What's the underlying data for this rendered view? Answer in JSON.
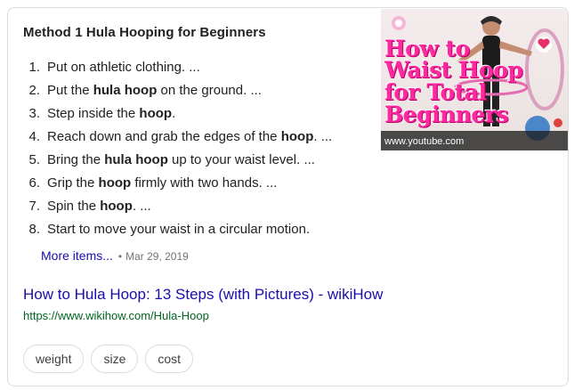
{
  "featured_snippet": {
    "title": "Method 1 Hula Hooping for Beginners",
    "steps": [
      {
        "num": "1.",
        "parts": [
          {
            "text": "Put on athletic clothing. ...",
            "bold": false
          }
        ]
      },
      {
        "num": "2.",
        "parts": [
          {
            "text": "Put the ",
            "bold": false
          },
          {
            "text": "hula hoop",
            "bold": true
          },
          {
            "text": " on the ground. ...",
            "bold": false
          }
        ]
      },
      {
        "num": "3.",
        "parts": [
          {
            "text": "Step inside the ",
            "bold": false
          },
          {
            "text": "hoop",
            "bold": true
          },
          {
            "text": ".",
            "bold": false
          }
        ]
      },
      {
        "num": "4.",
        "parts": [
          {
            "text": "Reach down and grab the edges of the ",
            "bold": false
          },
          {
            "text": "hoop",
            "bold": true
          },
          {
            "text": ". ...",
            "bold": false
          }
        ]
      },
      {
        "num": "5.",
        "parts": [
          {
            "text": "Bring the ",
            "bold": false
          },
          {
            "text": "hula hoop",
            "bold": true
          },
          {
            "text": " up to your waist level. ...",
            "bold": false
          }
        ]
      },
      {
        "num": "6.",
        "parts": [
          {
            "text": "Grip the ",
            "bold": false
          },
          {
            "text": "hoop",
            "bold": true
          },
          {
            "text": " firmly with two hands. ...",
            "bold": false
          }
        ]
      },
      {
        "num": "7.",
        "parts": [
          {
            "text": "Spin the ",
            "bold": false
          },
          {
            "text": "hoop",
            "bold": true
          },
          {
            "text": ". ...",
            "bold": false
          }
        ]
      },
      {
        "num": "8.",
        "parts": [
          {
            "text": "Start to move your waist in a circular motion.",
            "bold": false
          }
        ]
      }
    ],
    "more_items_label": "More items...",
    "separator": "•",
    "date": "Mar 29, 2019",
    "result_title": "How to Hula Hoop: 13 Steps (with Pictures) - wikiHow",
    "result_url": "https://www.wikihow.com/Hula-Hoop",
    "thumbnail": {
      "overlay_lines": [
        "How to",
        "Waist Hoop",
        "for Total",
        "Beginners"
      ],
      "caption": "www.youtube.com",
      "overlay_color": "#ff2aa0"
    }
  },
  "chips": [
    "weight",
    "size",
    "cost"
  ],
  "colors": {
    "link": "#1a0dab",
    "url": "#006621",
    "muted": "#70757a",
    "border": "#dadce0"
  }
}
